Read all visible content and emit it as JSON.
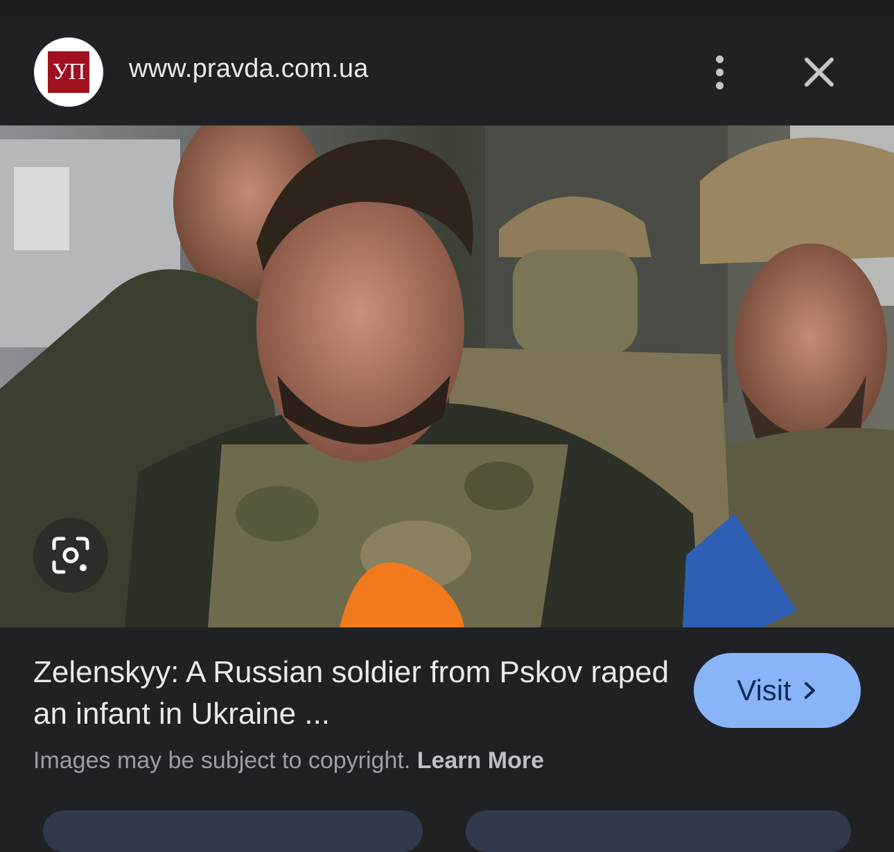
{
  "header": {
    "logo_text": "УП",
    "url": "www.pravda.com.ua",
    "more_icon": "more-vert-icon",
    "close_icon": "close-icon"
  },
  "image": {
    "description_icon": "lens-icon"
  },
  "result": {
    "title": "Zelenskyy: A Russian soldier from Pskov raped an infant in Ukraine ...",
    "visit_label": "Visit",
    "visit_icon": "chevron-right-icon",
    "copyright_text": "Images may be subject to copyright.",
    "learn_more_label": "Learn More"
  },
  "colors": {
    "background": "#202124",
    "accent": "#8ab4f8",
    "logo_red": "#a0111f"
  }
}
